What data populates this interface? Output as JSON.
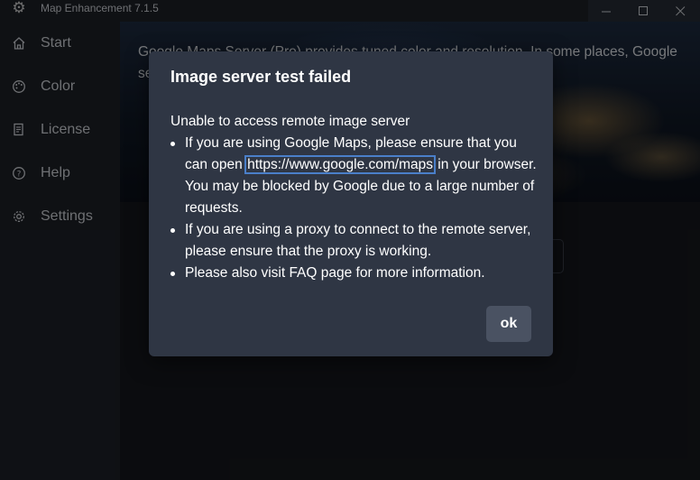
{
  "window": {
    "title": "Map Enhancement 7.1.5",
    "minimize_glyph": "—",
    "maximize_glyph": "☐",
    "close_glyph": "✕"
  },
  "sidebar": {
    "items": [
      {
        "label": "Start",
        "icon": "home-icon"
      },
      {
        "label": "Color",
        "icon": "palette-icon"
      },
      {
        "label": "License",
        "icon": "license-icon"
      },
      {
        "label": "Help",
        "icon": "help-icon"
      },
      {
        "label": "Settings",
        "icon": "gear-icon"
      }
    ]
  },
  "main": {
    "hero_text": "Google Maps Server (Pro) provides tuned color and resolution. In some places, Google se                                                                                                                    Sc                                                                        pick one to use."
  },
  "dialog": {
    "title": "Image server test failed",
    "intro": "Unable to access remote image server",
    "bullet1_before": "If you are using Google Maps, please ensure that you can open ",
    "bullet1_link": "https://www.google.com/maps",
    "bullet1_after": " in your browser. You may be blocked by Google due to a large number of requests.",
    "bullet2": "If you are using a proxy to connect to the remote server, please ensure that the proxy is working.",
    "bullet3": "Please also visit FAQ page for more information.",
    "ok_label": "ok"
  },
  "colors": {
    "background": "#1c1f26",
    "dialog_bg": "#2f3644",
    "ok_button_bg": "#4a5262",
    "link_focus_outline": "#4a7fc9"
  }
}
